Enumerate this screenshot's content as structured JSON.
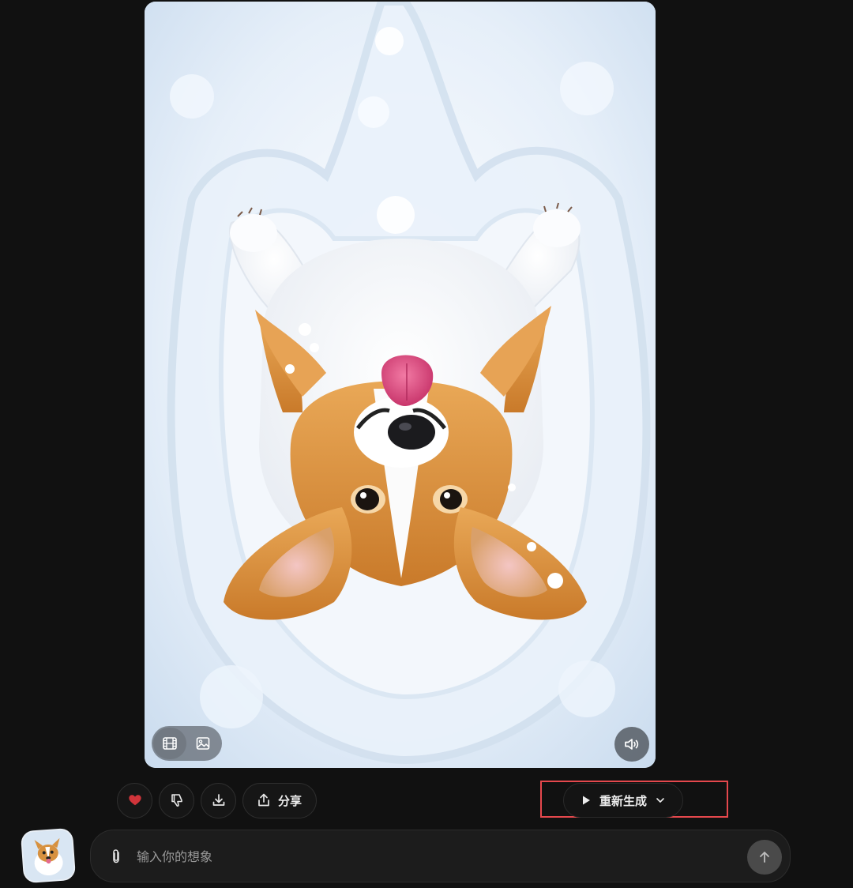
{
  "media": {
    "icons": {
      "video_mode": "film-icon",
      "image_mode": "image-icon",
      "volume": "speaker-icon"
    }
  },
  "actions": {
    "icons": {
      "like": "heart-icon",
      "dislike": "thumbs-down-icon",
      "download": "download-icon",
      "share": "share-icon"
    },
    "share_label": "分享",
    "regenerate_label": "重新生成"
  },
  "composer": {
    "placeholder": "输入你的想象"
  },
  "colors": {
    "background": "#111111",
    "highlight": "#e5484d",
    "like_active": "#d0343a"
  }
}
